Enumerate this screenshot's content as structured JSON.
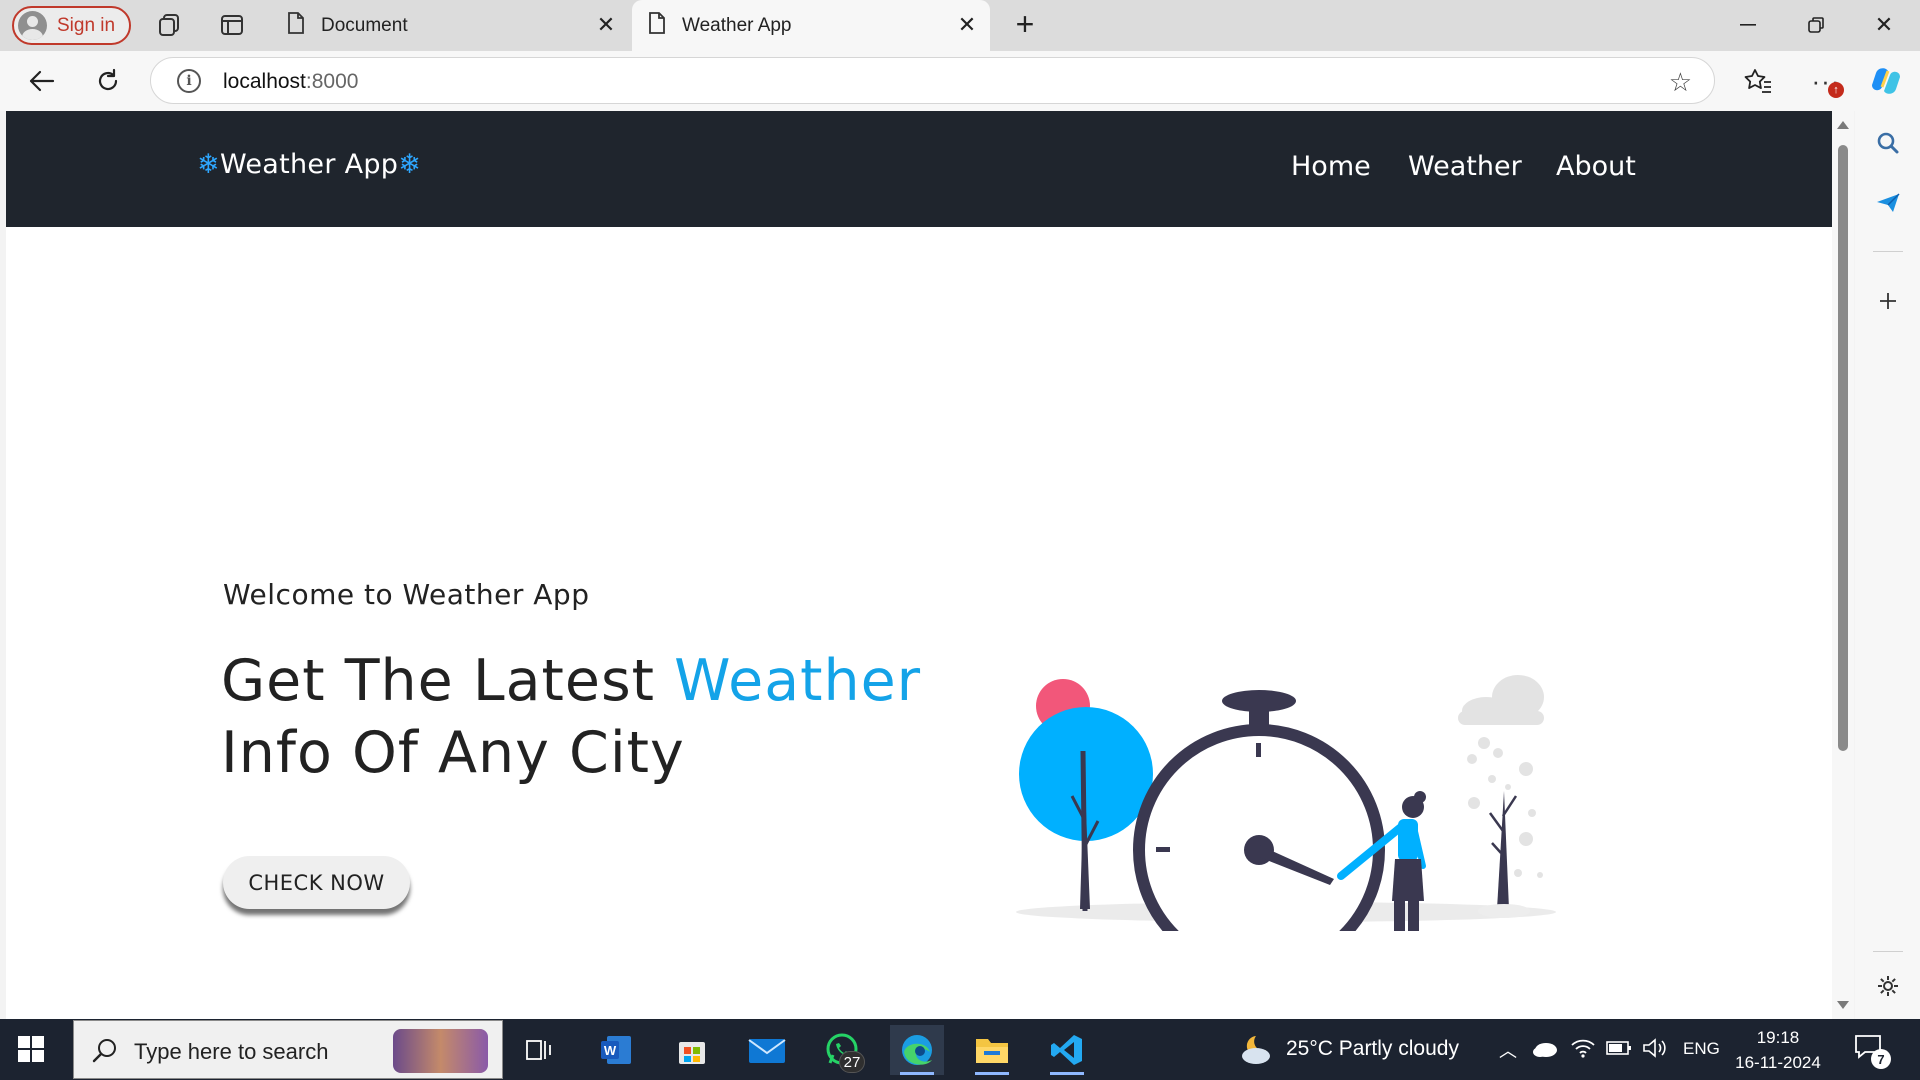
{
  "browser": {
    "sign_in_label": "Sign in",
    "tabs": [
      {
        "title": "Document",
        "active": false
      },
      {
        "title": "Weather App",
        "active": true
      }
    ],
    "address": {
      "host": "localhost",
      "port": ":8000"
    }
  },
  "site": {
    "brand": {
      "flake_left": "❄",
      "name": "Weather App",
      "flake_right": "❄"
    },
    "nav": [
      "Home",
      "Weather",
      "About"
    ],
    "hero": {
      "welcome": "Welcome to Weather App",
      "title_part1": "Get The Latest ",
      "title_accent": "Weather",
      "title_part2": "Info Of Any City",
      "cta_label": "CHECK NOW"
    },
    "colors": {
      "header_bg": "#1f252d",
      "accent": "#14a3e8",
      "tree_blue": "#00b0ff",
      "sun_pink": "#f2577a",
      "clock_dark": "#3a3850"
    }
  },
  "taskbar": {
    "search_placeholder": "Type here to search",
    "whatsapp_badge": "27",
    "weather": "25°C  Partly cloudy",
    "language": "ENG",
    "time": "19:18",
    "date": "16-11-2024",
    "notifications": "7",
    "apps": [
      "task-view-icon",
      "word-icon",
      "microsoft-store-icon",
      "mail-icon",
      "whatsapp-icon",
      "edge-icon",
      "file-explorer-icon",
      "vscode-icon"
    ]
  }
}
